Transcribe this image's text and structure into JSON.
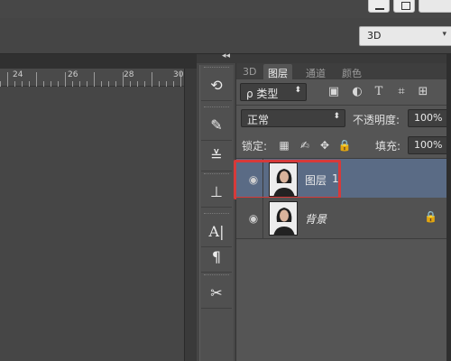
{
  "workspace": {
    "selected": "3D"
  },
  "ruler": {
    "ticks": [
      "24",
      "26",
      "28",
      "30"
    ]
  },
  "panel_tabs": [
    "3D",
    "图层",
    "通道",
    "颜色"
  ],
  "filter": {
    "label": "ρ 类型",
    "icons": [
      "image-filter-icon",
      "adjustment-filter-icon",
      "type-filter-icon",
      "shape-filter-icon",
      "smart-object-filter-icon"
    ]
  },
  "blend": {
    "mode": "正常",
    "opacity_label": "不透明度:",
    "opacity_value": "100%"
  },
  "lock": {
    "label": "锁定:",
    "fill_label": "填充:",
    "fill_value": "100%"
  },
  "layers": [
    {
      "name": "图层",
      "suffix": "1",
      "selected": true
    },
    {
      "name": "背景",
      "suffix": "",
      "selected": false,
      "locked": true
    }
  ],
  "dock_icons": [
    "history-icon",
    "brush-icon",
    "brush-presets-icon",
    "clone-source-icon",
    "character-icon",
    "paragraph-icon",
    "tool-presets-icon"
  ],
  "colors": {
    "selected_row": "#5a6b85",
    "highlight": "#d63a3a"
  }
}
